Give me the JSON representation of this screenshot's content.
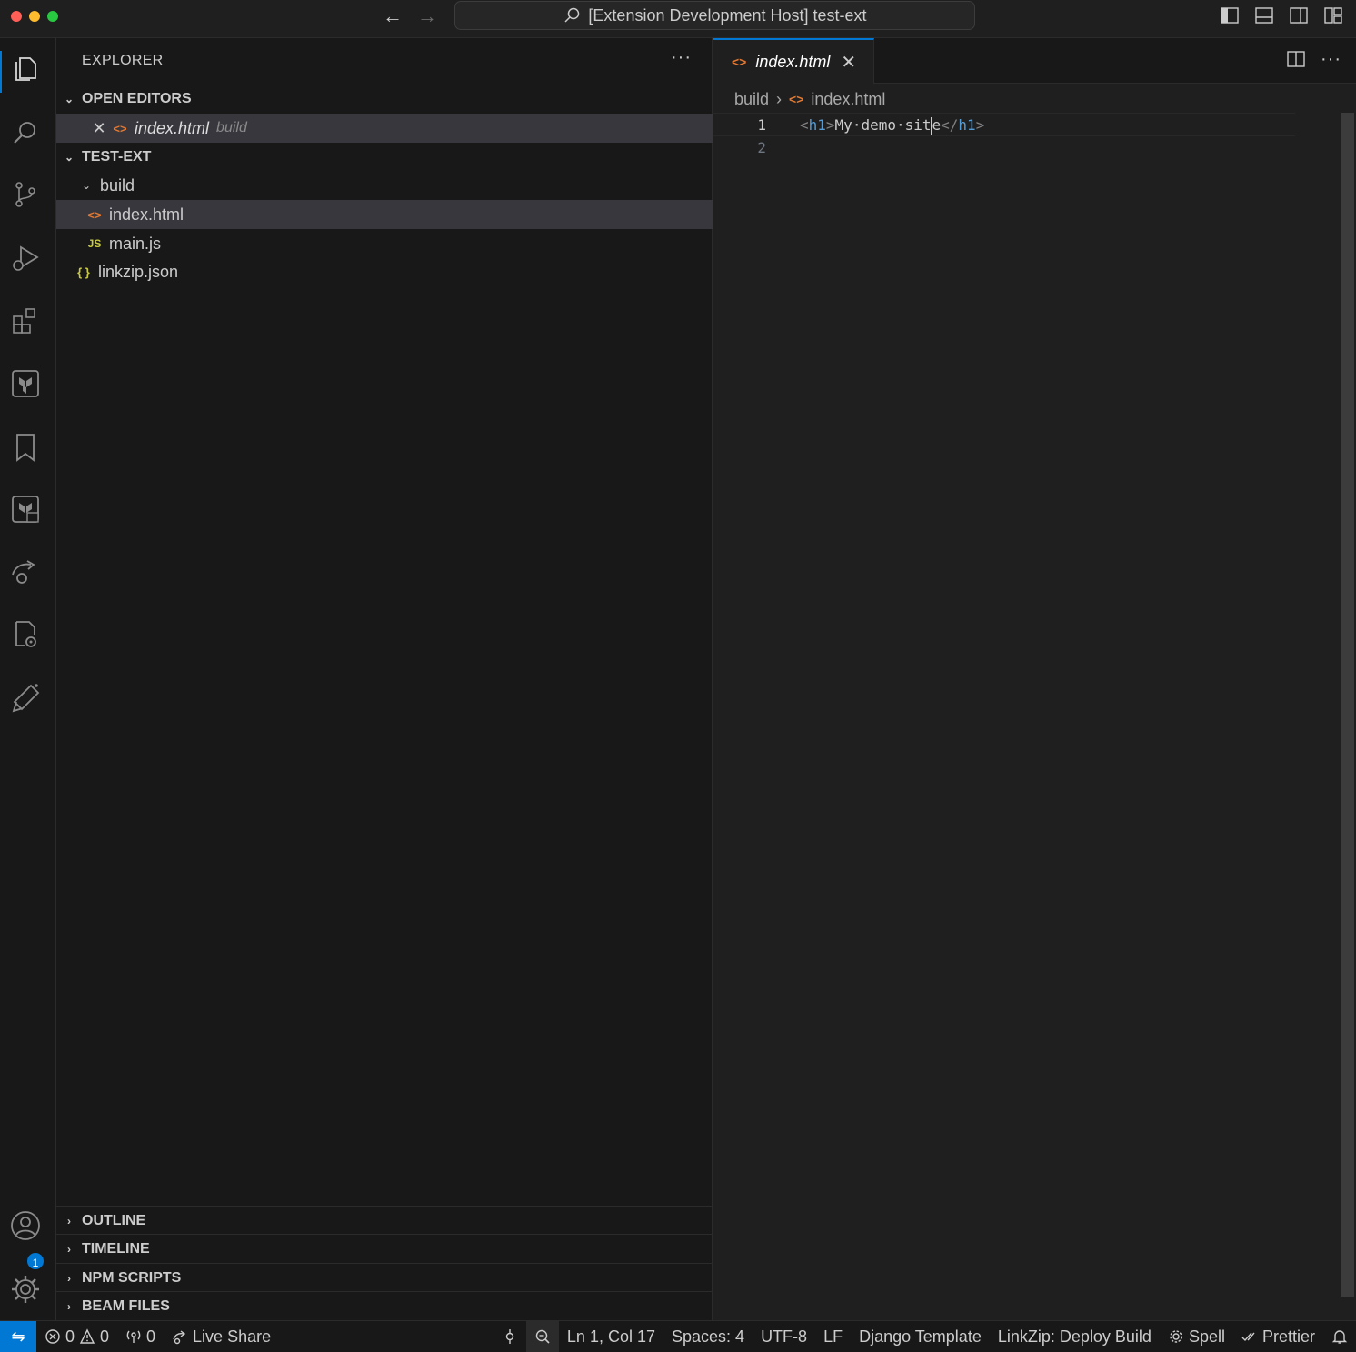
{
  "titlebar": {
    "search_text": "[Extension Development Host] test-ext"
  },
  "sidebar": {
    "title": "EXPLORER",
    "open_editors": {
      "header": "OPEN EDITORS",
      "items": [
        {
          "name": "index.html",
          "description": "build"
        }
      ]
    },
    "workspace": {
      "header": "TEST-EXT",
      "tree": [
        {
          "label": "build",
          "kind": "folder"
        },
        {
          "label": "index.html",
          "kind": "html"
        },
        {
          "label": "main.js",
          "kind": "js",
          "icon_text": "JS"
        },
        {
          "label": "linkzip.json",
          "kind": "json",
          "icon_text": "{ }"
        }
      ]
    },
    "collapsed_sections": [
      "OUTLINE",
      "TIMELINE",
      "NPM SCRIPTS",
      "BEAM FILES"
    ]
  },
  "editor": {
    "tab_label": "index.html",
    "breadcrumb": {
      "folder": "build",
      "file": "index.html"
    },
    "lines": [
      {
        "number": "1",
        "open_tag": "h1",
        "text_before_cursor": "My·demo·sit",
        "text_after_cursor": "e",
        "close_tag": "h1"
      },
      {
        "number": "2"
      }
    ]
  },
  "activity_bar": {
    "icons": [
      "explorer-icon",
      "search-icon",
      "source-control-icon",
      "run-debug-icon",
      "extensions-icon",
      "terraform-icon",
      "bookmark-icon",
      "terraform-cloud-icon",
      "remote-explorer-icon",
      "settings-sync-icon",
      "testing-icon",
      "accounts-icon",
      "manage-gear-icon"
    ],
    "manage_badge": "1"
  },
  "statusbar": {
    "errors": "0",
    "warnings": "0",
    "ports": "0",
    "live_share": "Live Share",
    "cursor_position": "Ln 1, Col 17",
    "indentation": "Spaces: 4",
    "encoding": "UTF-8",
    "eol": "LF",
    "language": "Django Template",
    "linkzip": "LinkZip: Deploy Build",
    "spell": "Spell",
    "prettier": "Prettier"
  },
  "colors": {
    "accent": "#0078d4",
    "html_icon": "#e37933",
    "js_icon": "#cbcb41",
    "tag_name": "#569cd6"
  }
}
